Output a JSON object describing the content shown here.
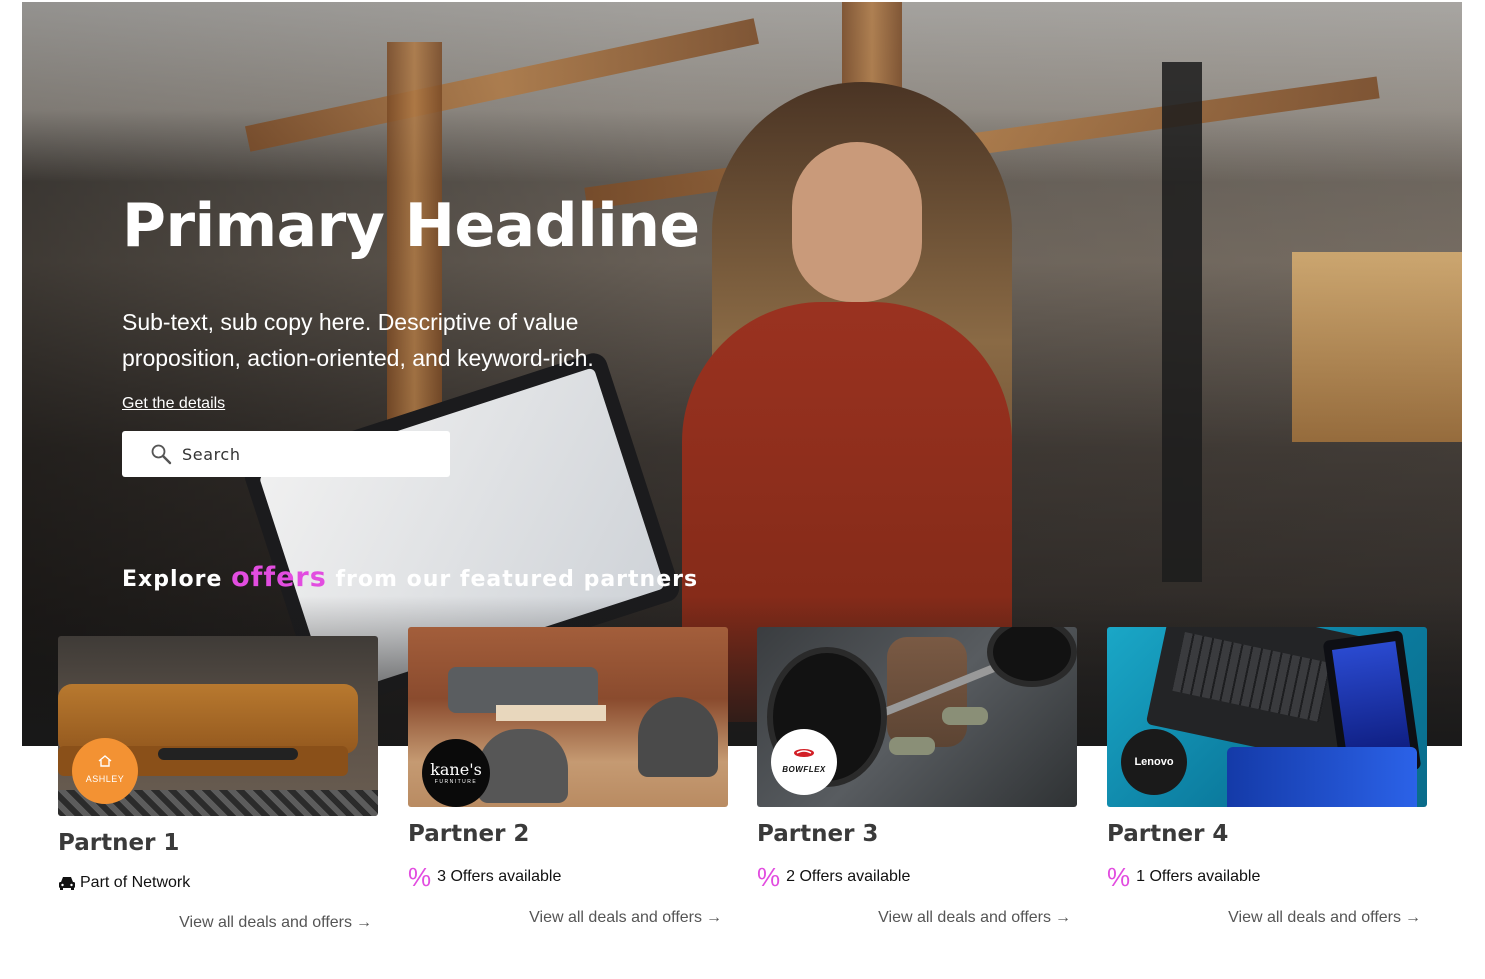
{
  "hero": {
    "headline": "Primary Headline",
    "subtext": "Sub-text, sub copy here. Descriptive of value proposition, action-oriented, and keyword-rich.",
    "link": "Get the details",
    "search_placeholder": "Search",
    "explore_before": "Explore ",
    "explore_accent": "offers",
    "explore_after": " from our featured partners"
  },
  "colors": {
    "accent": "#e24de0",
    "ashley_logo": "#f39233",
    "text_dark": "#3a3a3a"
  },
  "partners": [
    {
      "name": "Partner 1",
      "logo_text": "ASHLEY",
      "meta_icon": "car-icon",
      "meta_text": "Part of Network",
      "view_link": "View all deals and offers",
      "arrow": "→"
    },
    {
      "name": "Partner 2",
      "logo_text": "kane's",
      "logo_subtext": "FURNITURE",
      "meta_icon": "percent-icon",
      "meta_text": "3 Offers available",
      "view_link": "View all deals and offers",
      "arrow": "→"
    },
    {
      "name": "Partner 3",
      "logo_text": "BOWFLEX",
      "meta_icon": "percent-icon",
      "meta_text": "2 Offers available",
      "view_link": "View all deals and offers",
      "arrow": "→"
    },
    {
      "name": "Partner 4",
      "logo_text": "Lenovo",
      "meta_icon": "percent-icon",
      "meta_text": "1 Offers available",
      "view_link": "View all deals and offers",
      "arrow": "→"
    }
  ],
  "percent_symbol": "%"
}
